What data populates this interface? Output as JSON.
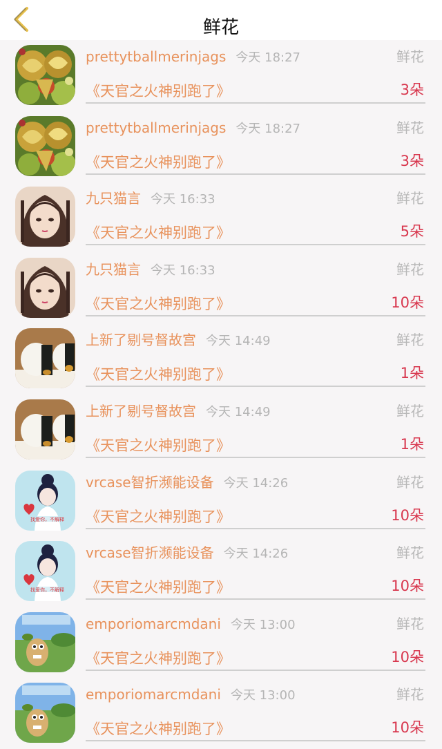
{
  "header": {
    "title": "鲜花",
    "back_icon": "chevron-left-icon"
  },
  "colors": {
    "name": "#e8925c",
    "count": "#d8374e",
    "muted": "#b8b8b8"
  },
  "rows": [
    {
      "user": "prettytballmerinjags",
      "time": "今天 18:27",
      "type": "鲜花",
      "book": "《天官之火神别跑了》",
      "count": "3朵",
      "avatar": "fruit-carving"
    },
    {
      "user": "prettytballmerinjags",
      "time": "今天 18:27",
      "type": "鲜花",
      "book": "《天官之火神别跑了》",
      "count": "3朵",
      "avatar": "fruit-carving"
    },
    {
      "user": "九只猫言",
      "time": "今天 16:33",
      "type": "鲜花",
      "book": "《天官之火神别跑了》",
      "count": "5朵",
      "avatar": "anime-girl"
    },
    {
      "user": "九只猫言",
      "time": "今天 16:33",
      "type": "鲜花",
      "book": "《天官之火神别跑了》",
      "count": "10朵",
      "avatar": "anime-girl"
    },
    {
      "user": "上新了剔号督故宫",
      "time": "今天 14:49",
      "type": "鲜花",
      "book": "《天官之火神别跑了》",
      "count": "1朵",
      "avatar": "sushi"
    },
    {
      "user": "上新了剔号督故宫",
      "time": "今天 14:49",
      "type": "鲜花",
      "book": "《天官之火神别跑了》",
      "count": "1朵",
      "avatar": "sushi"
    },
    {
      "user": "vrcase智折濒能设备",
      "time": "今天 14:26",
      "type": "鲜花",
      "book": "《天官之火神别跑了》",
      "count": "10朵",
      "avatar": "cartoon-girl"
    },
    {
      "user": "vrcase智折濒能设备",
      "time": "今天 14:26",
      "type": "鲜花",
      "book": "《天官之火神别跑了》",
      "count": "10朵",
      "avatar": "cartoon-girl"
    },
    {
      "user": "emporiomarcmdani",
      "time": "今天 13:00",
      "type": "鲜花",
      "book": "《天官之火神别跑了》",
      "count": "10朵",
      "avatar": "cartoon-creature"
    },
    {
      "user": "emporiomarcmdani",
      "time": "今天 13:00",
      "type": "鲜花",
      "book": "《天官之火神别跑了》",
      "count": "10朵",
      "avatar": "cartoon-creature"
    }
  ]
}
